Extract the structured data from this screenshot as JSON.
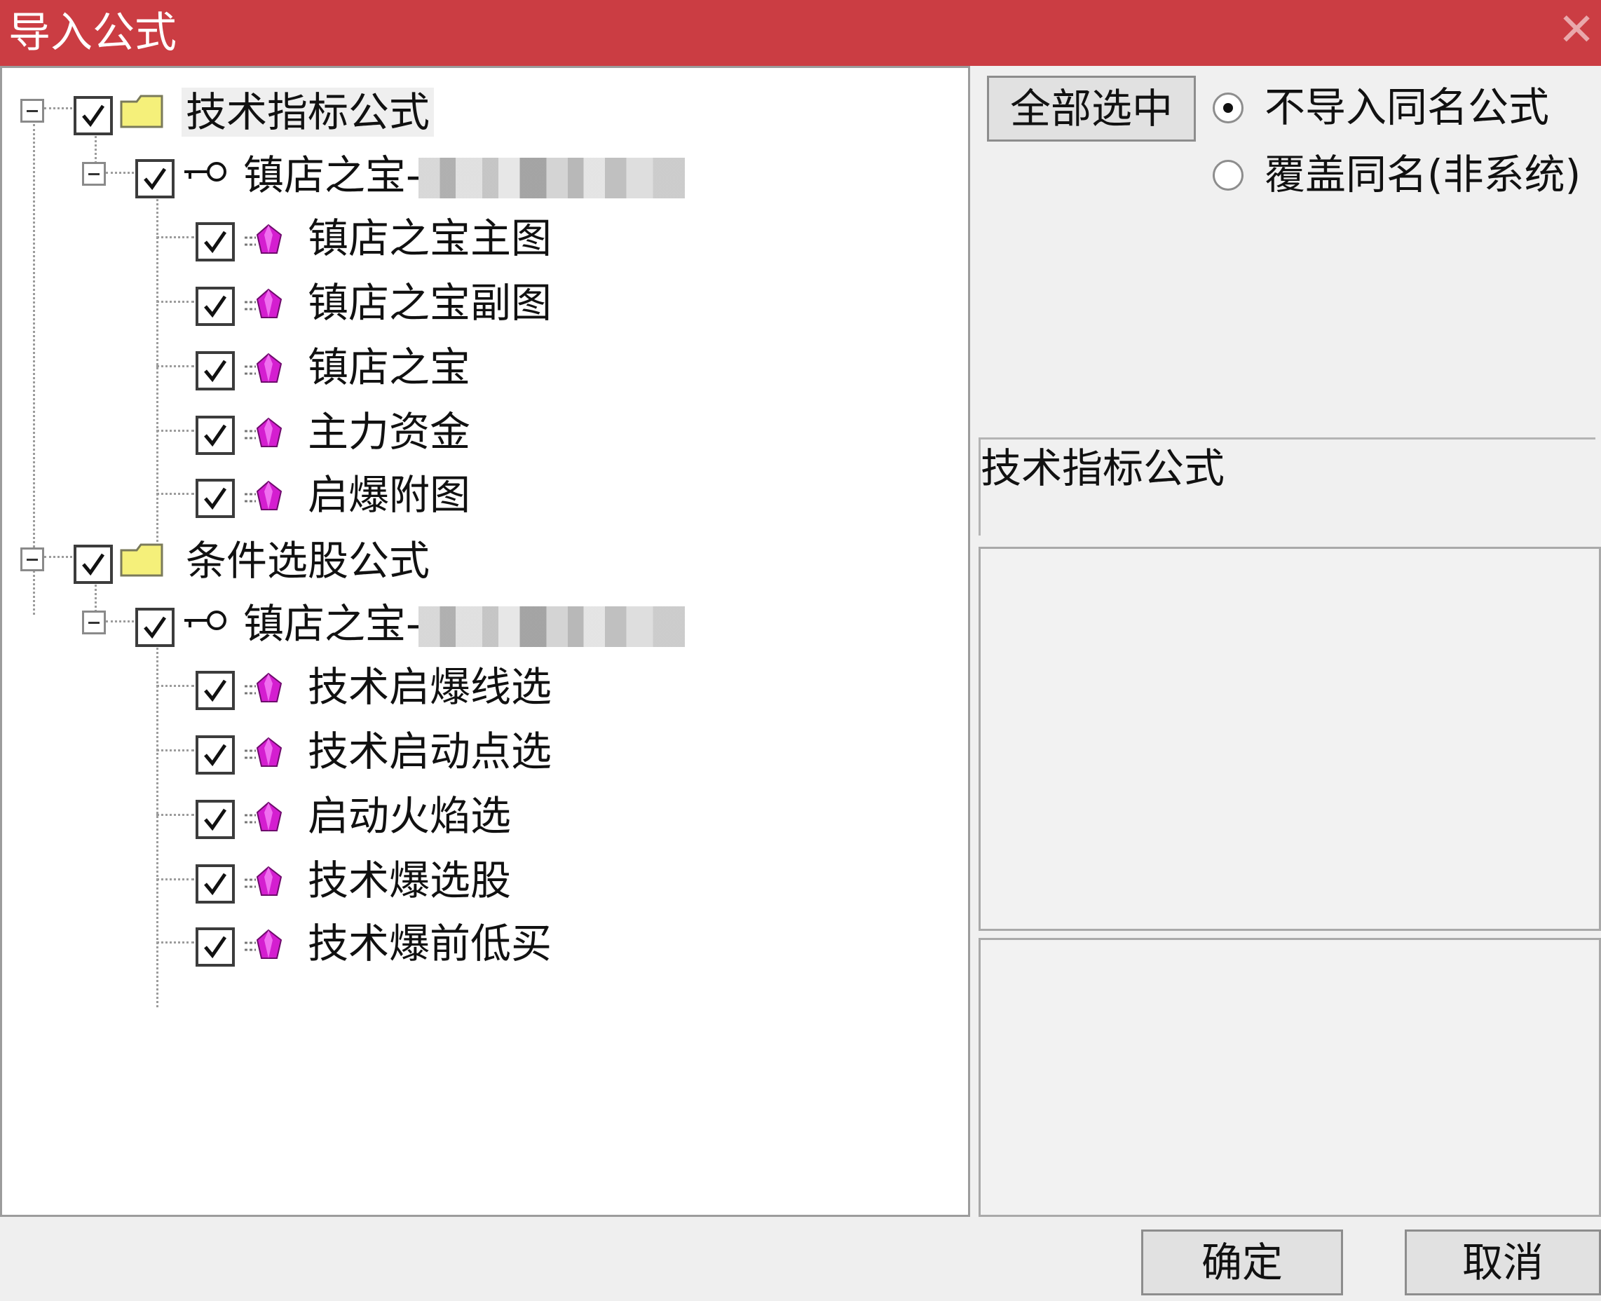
{
  "window": {
    "title": "导入公式",
    "close_glyph": "✕"
  },
  "tree": {
    "groups": [
      {
        "label": "技术指标公式",
        "checked": true,
        "icon": "folder-icon",
        "child": {
          "label": "镇店之宝-",
          "icon": "key-icon",
          "checked": true,
          "items": [
            "镇店之宝主图",
            "镇店之宝副图",
            "镇店之宝",
            "主力资金",
            "启爆附图"
          ]
        }
      },
      {
        "label": "条件选股公式",
        "checked": true,
        "icon": "folder-icon",
        "child": {
          "label": "镇店之宝-",
          "icon": "key-icon",
          "checked": true,
          "items": [
            "技术启爆线选",
            "技术启动点选",
            "启动火焰选",
            "技术爆选股",
            "技术爆前低买"
          ]
        }
      }
    ]
  },
  "right": {
    "select_all_label": "全部选中",
    "options": [
      {
        "label": "不导入同名公式",
        "checked": true
      },
      {
        "label": "覆盖同名(非系统)",
        "checked": false
      }
    ],
    "info_text": "技术指标公式"
  },
  "footer": {
    "ok_label": "确定",
    "cancel_label": "取消"
  },
  "colors": {
    "titlebar": "#cb3d43",
    "gem": "#d41ed0",
    "folder": "#f5f07a"
  }
}
